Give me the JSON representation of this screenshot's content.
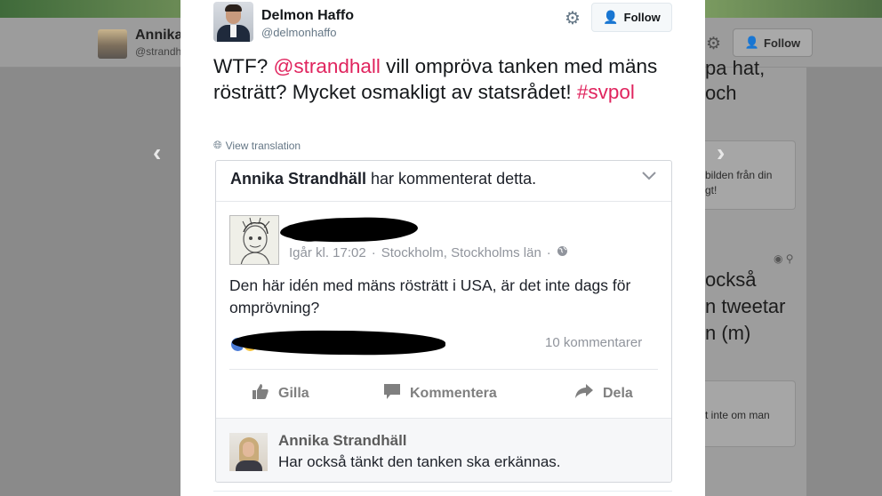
{
  "background": {
    "profile": {
      "name": "Annika",
      "handle": "@strandh",
      "follow_label": "Follow"
    },
    "right_column": {
      "lines_top": [
        "pa hat,",
        "och"
      ],
      "card1_lines": [
        "bilden från din",
        "gt!"
      ],
      "lines_mid": [
        "också",
        "n tweetar",
        "n (m)"
      ],
      "card2_lines": [
        "t inte om man"
      ]
    }
  },
  "tweet": {
    "author_name": "Delmon Haffo",
    "author_handle": "@delmonhaffo",
    "follow_label": "Follow",
    "text_prefix": "WTF? ",
    "mention": "@strandhall",
    "text_middle": " vill ompröva tanken med mäns rösträtt? Mycket osmakligt av statsrådet! ",
    "hashtag": "#svpol",
    "view_translation": "View translation"
  },
  "embedded_facebook": {
    "header_name": "Annika Strandhäll",
    "header_action": " har kommenterat detta.",
    "post_time": "Igår kl. 17:02",
    "post_location": "Stockholm, Stockholms län",
    "post_text": "Den här idén med mäns rösträtt i USA, är det inte dags för omprövning?",
    "comment_count": "10 kommentarer",
    "actions": {
      "like": "Gilla",
      "comment": "Kommentera",
      "share": "Dela"
    },
    "comment": {
      "author": "Annika Strandhäll",
      "text": "Har också tänkt den tanken ska erkännas."
    }
  },
  "colors": {
    "link": "#e0245e",
    "twitter_blue": "#1da1f2",
    "fb_grey": "#90949c"
  }
}
